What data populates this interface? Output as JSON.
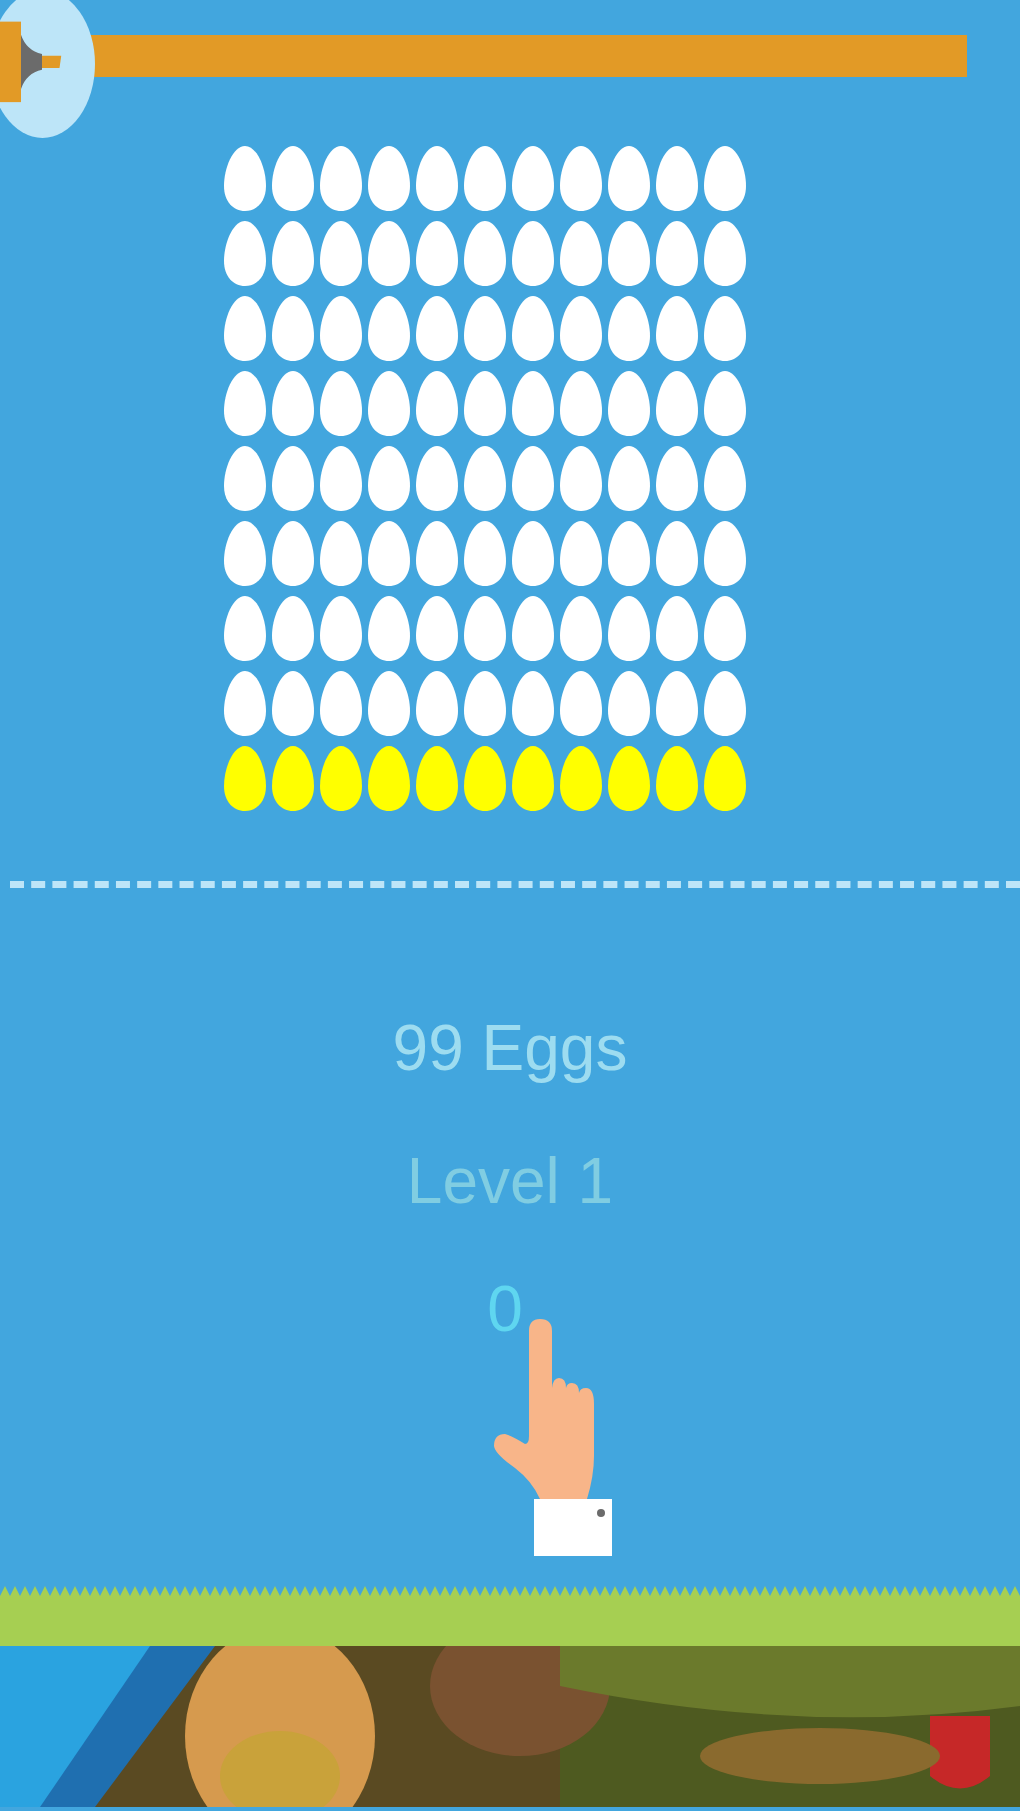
{
  "timer": {
    "level": 1
  },
  "egg_rows": [
    {
      "eggs": [
        {
          "color": "#ffffff"
        },
        {
          "color": "#ffffff"
        },
        {
          "color": "#ffffff"
        },
        {
          "color": "#ffffff"
        },
        {
          "color": "#ffffff"
        },
        {
          "color": "#ffffff"
        },
        {
          "color": "#ffffff"
        },
        {
          "color": "#ffffff"
        },
        {
          "color": "#ffffff"
        },
        {
          "color": "#ffffff"
        },
        {
          "color": "#ffffff"
        }
      ]
    },
    {
      "eggs": [
        {
          "color": "#ffffff"
        },
        {
          "color": "#ffffff"
        },
        {
          "color": "#ffffff"
        },
        {
          "color": "#ffffff"
        },
        {
          "color": "#ffffff"
        },
        {
          "color": "#ffffff"
        },
        {
          "color": "#ffffff"
        },
        {
          "color": "#ffffff"
        },
        {
          "color": "#ffffff"
        },
        {
          "color": "#ffffff"
        },
        {
          "color": "#ffffff"
        }
      ]
    },
    {
      "eggs": [
        {
          "color": "#ffffff"
        },
        {
          "color": "#ffffff"
        },
        {
          "color": "#ffffff"
        },
        {
          "color": "#ffffff"
        },
        {
          "color": "#ffffff"
        },
        {
          "color": "#ffffff"
        },
        {
          "color": "#ffffff"
        },
        {
          "color": "#ffffff"
        },
        {
          "color": "#ffffff"
        },
        {
          "color": "#ffffff"
        },
        {
          "color": "#ffffff"
        }
      ]
    },
    {
      "eggs": [
        {
          "color": "#ffffff"
        },
        {
          "color": "#ffffff"
        },
        {
          "color": "#ffffff"
        },
        {
          "color": "#ffffff"
        },
        {
          "color": "#ffffff"
        },
        {
          "color": "#ffffff"
        },
        {
          "color": "#ffffff"
        },
        {
          "color": "#ffffff"
        },
        {
          "color": "#ffffff"
        },
        {
          "color": "#ffffff"
        },
        {
          "color": "#ffffff"
        }
      ]
    },
    {
      "eggs": [
        {
          "color": "#ffffff"
        },
        {
          "color": "#ffffff"
        },
        {
          "color": "#ffffff"
        },
        {
          "color": "#ffffff"
        },
        {
          "color": "#ffffff"
        },
        {
          "color": "#ffffff"
        },
        {
          "color": "#ffffff"
        },
        {
          "color": "#ffffff"
        },
        {
          "color": "#ffffff"
        },
        {
          "color": "#ffffff"
        },
        {
          "color": "#ffffff"
        }
      ]
    },
    {
      "eggs": [
        {
          "color": "#ffffff"
        },
        {
          "color": "#ffffff"
        },
        {
          "color": "#ffffff"
        },
        {
          "color": "#ffffff"
        },
        {
          "color": "#ffffff"
        },
        {
          "color": "#ffffff"
        },
        {
          "color": "#ffffff"
        },
        {
          "color": "#ffffff"
        },
        {
          "color": "#ffffff"
        },
        {
          "color": "#ffffff"
        },
        {
          "color": "#ffffff"
        }
      ]
    },
    {
      "eggs": [
        {
          "color": "#ffffff"
        },
        {
          "color": "#ffffff"
        },
        {
          "color": "#ffffff"
        },
        {
          "color": "#ffffff"
        },
        {
          "color": "#ffffff"
        },
        {
          "color": "#ffffff"
        },
        {
          "color": "#ffffff"
        },
        {
          "color": "#ffffff"
        },
        {
          "color": "#ffffff"
        },
        {
          "color": "#ffffff"
        },
        {
          "color": "#ffffff"
        }
      ]
    },
    {
      "eggs": [
        {
          "color": "#ffffff"
        },
        {
          "color": "#ffffff"
        },
        {
          "color": "#ffffff"
        },
        {
          "color": "#ffffff"
        },
        {
          "color": "#ffffff"
        },
        {
          "color": "#ffffff"
        },
        {
          "color": "#ffffff"
        },
        {
          "color": "#ffffff"
        },
        {
          "color": "#ffffff"
        },
        {
          "color": "#ffffff"
        },
        {
          "color": "#ffffff"
        }
      ]
    },
    {
      "eggs": [
        {
          "color": "#ffff00"
        },
        {
          "color": "#ffff00"
        },
        {
          "color": "#ffff00"
        },
        {
          "color": "#ffff00"
        },
        {
          "color": "#ffff00"
        },
        {
          "color": "#ffff00"
        },
        {
          "color": "#ffff00"
        },
        {
          "color": "#ffff00"
        },
        {
          "color": "#ffff00"
        },
        {
          "color": "#ffff00"
        },
        {
          "color": "#ffff00"
        }
      ]
    }
  ],
  "eggs_left": "99 Eggs",
  "level": "Level 1",
  "score": "0"
}
